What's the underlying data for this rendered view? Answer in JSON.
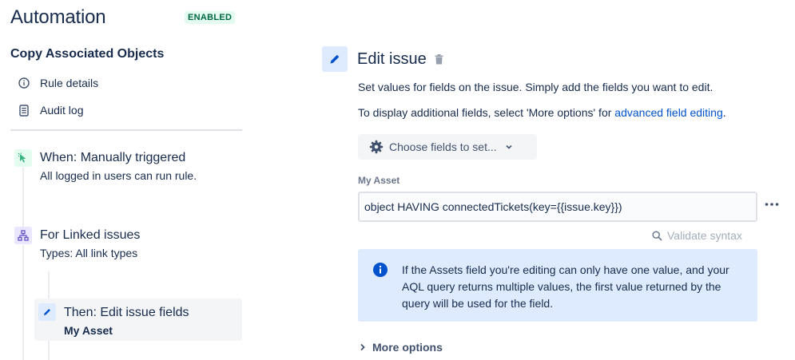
{
  "header": {
    "title": "Automation",
    "status_badge": "ENABLED"
  },
  "sidebar": {
    "rule_name": "Copy Associated Objects",
    "nav": [
      {
        "label": "Rule details",
        "icon": "info-icon"
      },
      {
        "label": "Audit log",
        "icon": "document-icon"
      }
    ],
    "steps": [
      {
        "title": "When: Manually triggered",
        "subtitle": "All logged in users can run rule.",
        "icon": "cursor-trigger-icon",
        "icon_color": "#36b37e",
        "icon_bg": "#e3fcef"
      },
      {
        "title": "For Linked issues",
        "subtitle": "Types: All link types",
        "icon": "hierarchy-icon",
        "icon_color": "#6554c0",
        "icon_bg": "#eae6ff"
      },
      {
        "title": "Then: Edit issue fields",
        "subtitle": "My Asset",
        "icon": "pencil-icon",
        "icon_color": "#0052cc",
        "icon_bg": "#deebff",
        "selected": true
      }
    ]
  },
  "panel": {
    "title": "Edit issue",
    "description": "Set values for fields on the issue. Simply add the fields you want to edit.",
    "additional_prefix": "To display additional fields, select 'More options' for ",
    "additional_link": "advanced field editing",
    "additional_suffix": ".",
    "choose_fields_label": "Choose fields to set...",
    "field": {
      "label": "My Asset",
      "value": "object HAVING connectedTickets(key={{issue.key}})"
    },
    "validate_label": "Validate syntax",
    "info_message": "If the Assets field you're editing can only have one value, and your AQL query returns multiple values, the first value returned by the query will be used for the field.",
    "more_options_label": "More options"
  },
  "colors": {
    "accent": "#0052cc",
    "enabled_badge_bg": "#e3fcef",
    "enabled_badge_text": "#006644",
    "info_bg": "#deebff",
    "selected_step_bg": "#f4f5f7"
  }
}
